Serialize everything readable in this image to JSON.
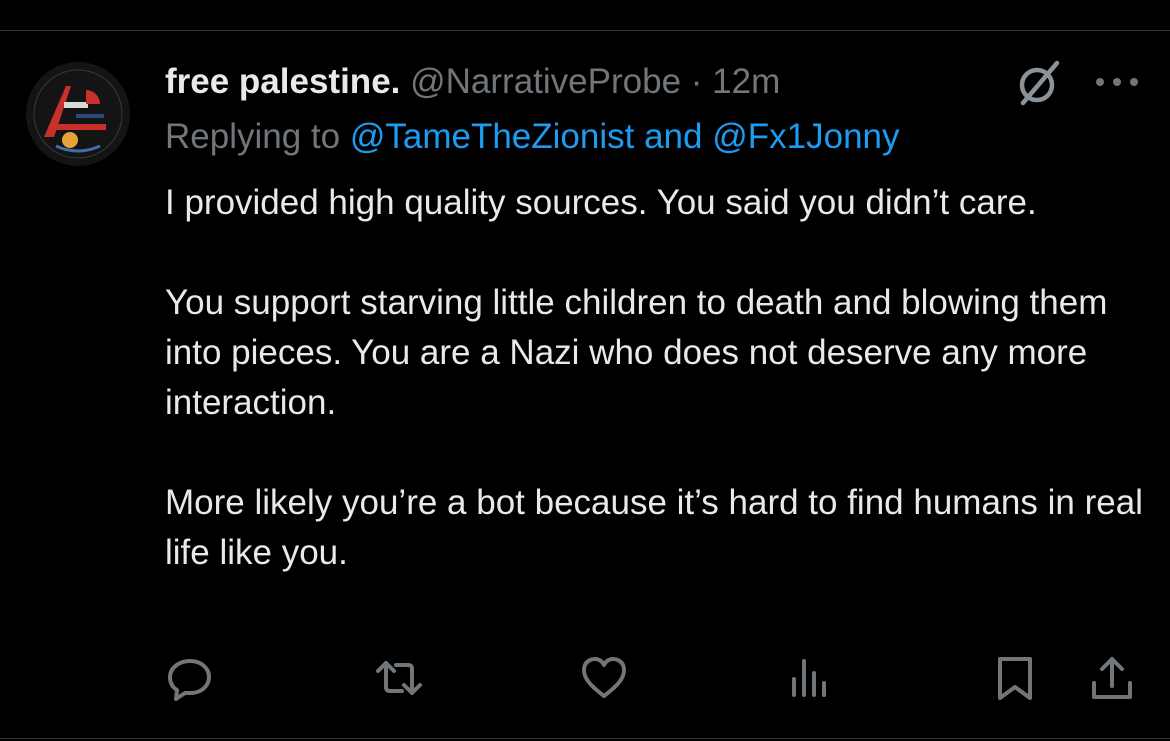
{
  "tweet": {
    "display_name": "free palestine.",
    "handle": "@NarrativeProbe",
    "separator": "·",
    "time": "12m",
    "replying_prefix": "Replying to",
    "reply_user_1": "@TameTheZionist",
    "reply_and": "and",
    "reply_user_2": "@Fx1Jonny",
    "paragraphs": [
      "I provided high quality sources. You said you didn’t care.",
      "You support starving little children to death and blowing them into pieces. You are a Nazi who does not deserve any more interaction.",
      "More likely you’re a bot because it’s hard to find humans in real life like you."
    ]
  },
  "header_icons": [
    "grok-icon",
    "more-icon"
  ],
  "actions": [
    "reply-icon",
    "retweet-icon",
    "like-icon",
    "views-icon",
    "bookmark-icon",
    "share-icon"
  ],
  "colors": {
    "background": "#000000",
    "text": "#e7e9ea",
    "muted": "#71767b",
    "link": "#1d9bf0"
  }
}
